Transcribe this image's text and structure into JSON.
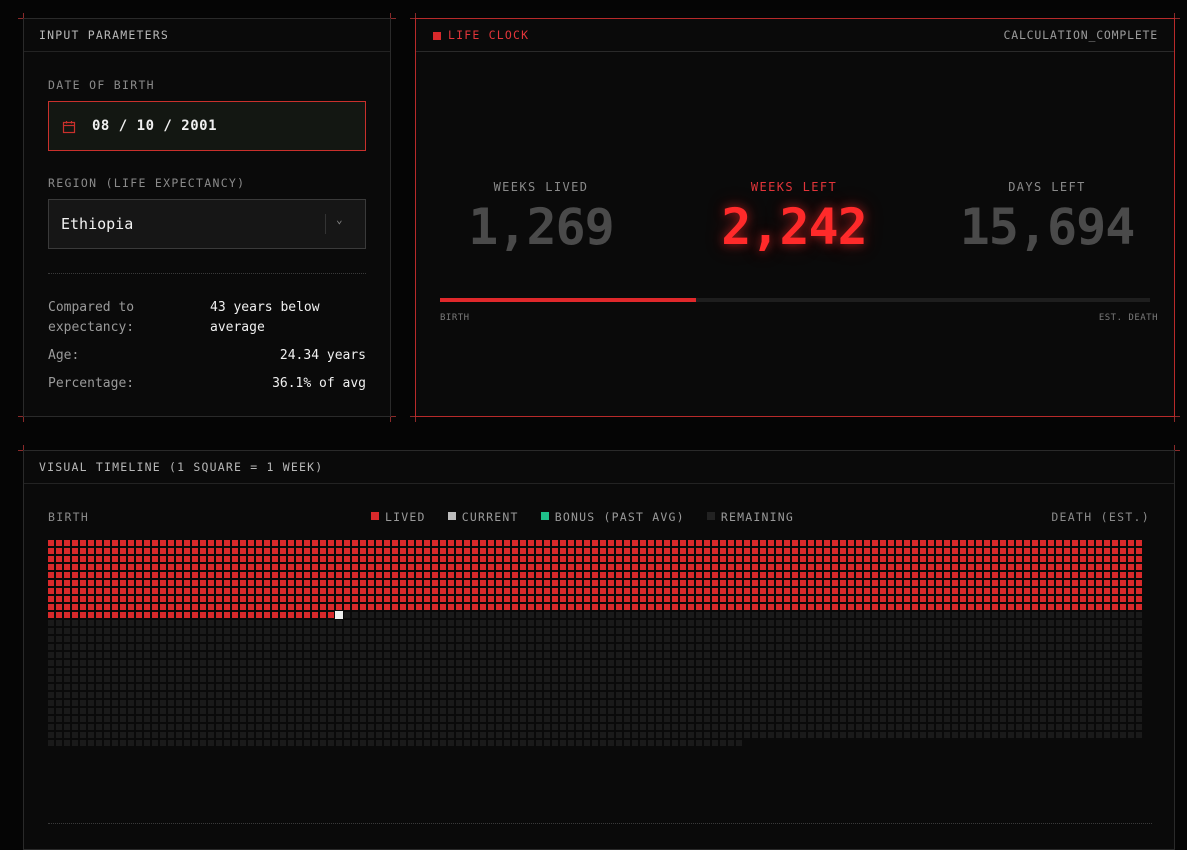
{
  "input_panel": {
    "title": "INPUT PARAMETERS",
    "dob_label": "DATE OF BIRTH",
    "dob_value": "08 / 10 / 2001",
    "region_label": "REGION (LIFE EXPECTANCY)",
    "region_value": "Ethiopia",
    "stats": {
      "compared_label_1": "Compared to",
      "compared_label_2": "expectancy:",
      "compared_value_1": "43 years below",
      "compared_value_2": "average",
      "age_label": "Age:",
      "age_value": "24.34 years",
      "pct_label": "Percentage:",
      "pct_value": "36.1% of avg"
    }
  },
  "life_clock": {
    "title": "LIFE CLOCK",
    "status": "CALCULATION_COMPLETE",
    "weeks_lived_label": "WEEKS LIVED",
    "weeks_lived_value": "1,269",
    "weeks_left_label": "WEEKS LEFT",
    "weeks_left_value": "2,242",
    "days_left_label": "DAYS LEFT",
    "days_left_value": "15,694",
    "progress_fraction": 0.361,
    "start_label": "BIRTH",
    "end_label": "EST. DEATH"
  },
  "timeline": {
    "title": "VISUAL TIMELINE (1 SQUARE = 1 WEEK)",
    "start_label": "BIRTH",
    "end_label": "DEATH (EST.)",
    "legend": {
      "lived": "LIVED",
      "current": "CURRENT",
      "bonus": "BONUS (PAST AVG)",
      "remaining": "REMAINING"
    },
    "weeks_lived": 1269,
    "weeks_total": 3512,
    "colors": {
      "lived": "#d8292b",
      "current": "#eeeeee",
      "bonus": "#1fbf8a",
      "remaining": "#1a1a1a"
    }
  },
  "colors": {
    "accent": "#e2353a",
    "background": "#050505"
  }
}
